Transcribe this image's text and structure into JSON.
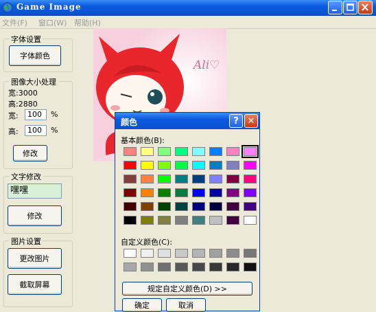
{
  "window": {
    "title": "Game Image"
  },
  "menu": [
    "文件(F)",
    "窗口(W)",
    "帮助(H)"
  ],
  "font_group": {
    "label": "字体设置",
    "color_button": "字体颜色"
  },
  "resize_group": {
    "label": "图像大小处理",
    "width_text": "宽:3000",
    "height_text": "高:2880",
    "width_label": "宽:",
    "width_value": "100",
    "height_label": "高:",
    "height_value": "100",
    "percent": "%",
    "modify_button": "修改"
  },
  "text_group": {
    "label": "文字修改",
    "text_value": "嘿嘿",
    "modify_button": "修改"
  },
  "picture_group": {
    "label": "图片设置",
    "change_button": "更改图片",
    "capture_button": "截取屏幕"
  },
  "picture": {
    "caption": "Ali♡"
  },
  "color_dialog": {
    "title": "颜色",
    "help_glyph": "?",
    "close_glyph": "✕",
    "basic_label": "基本颜色(B):",
    "custom_label": "自定义颜色(C):",
    "define_button": "规定自定义颜色(D) >>",
    "ok_button": "确定",
    "cancel_button": "取消",
    "selected_basic_index": 7,
    "basic_colors": [
      "#ff8080",
      "#ffff80",
      "#80ff80",
      "#00ff80",
      "#80ffff",
      "#0080ff",
      "#ff80c0",
      "#ff80ff",
      "#ff0000",
      "#ffff00",
      "#80ff00",
      "#00ff40",
      "#00ffff",
      "#0080c0",
      "#8080c0",
      "#ff00ff",
      "#804040",
      "#ff8040",
      "#00ff00",
      "#008080",
      "#004080",
      "#8080ff",
      "#800040",
      "#ff0080",
      "#800000",
      "#ff8000",
      "#008000",
      "#008040",
      "#0000ff",
      "#0000a0",
      "#800080",
      "#8000ff",
      "#400000",
      "#804000",
      "#004000",
      "#004040",
      "#000080",
      "#000040",
      "#400040",
      "#400080",
      "#000000",
      "#808000",
      "#808040",
      "#808080",
      "#408080",
      "#c0c0c0",
      "#400040",
      "#ffffff"
    ],
    "custom_colors": [
      "#ffffff",
      "#f0f0f0",
      "#e0e0e0",
      "#c8c8c8",
      "#b4b4b4",
      "#a0a0a0",
      "#8c8c8c",
      "#787878",
      "#a8a8a8",
      "#909090",
      "#707070",
      "#585858",
      "#484848",
      "#383838",
      "#282828",
      "#101010"
    ]
  }
}
